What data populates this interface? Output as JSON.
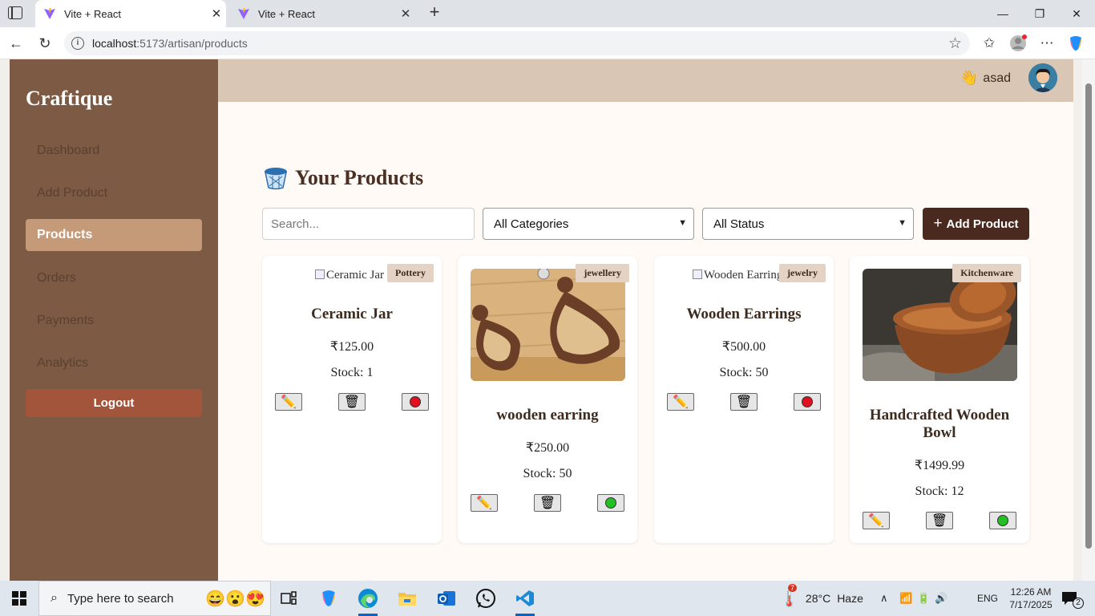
{
  "browser": {
    "tabs": [
      {
        "title": "Vite + React",
        "active": true
      },
      {
        "title": "Vite + React",
        "active": false
      }
    ],
    "url_host": "localhost",
    "url_rest": ":5173/artisan/products"
  },
  "sidebar": {
    "brand": "Craftique",
    "items": [
      {
        "label": "Dashboard",
        "active": false
      },
      {
        "label": "Add Product",
        "active": false
      },
      {
        "label": "Products",
        "active": true
      },
      {
        "label": "Orders",
        "active": false
      },
      {
        "label": "Payments",
        "active": false
      },
      {
        "label": "Analytics",
        "active": false
      }
    ],
    "logout_label": "Logout"
  },
  "header": {
    "username": "asad"
  },
  "page": {
    "title": "Your Products",
    "search_placeholder": "Search...",
    "category_filter": "All Categories",
    "status_filter": "All Status",
    "add_button": "Add Product"
  },
  "products": [
    {
      "name": "Ceramic Jar",
      "category": "Pottery",
      "price": "₹125.00",
      "stock": "Stock: 1",
      "image_alt": "Ceramic Jar",
      "status": "inactive"
    },
    {
      "name": "wooden earring",
      "category": "jewellery",
      "price": "₹250.00",
      "stock": "Stock: 50",
      "image_alt": "",
      "status": "active"
    },
    {
      "name": "Wooden Earrings",
      "category": "jewelry",
      "price": "₹500.00",
      "stock": "Stock: 50",
      "image_alt": "Wooden Earrings",
      "status": "inactive"
    },
    {
      "name": "Handcrafted Wooden Bowl",
      "category": "Kitchenware",
      "price": "₹1499.99",
      "stock": "Stock: 12",
      "image_alt": "",
      "status": "active"
    }
  ],
  "taskbar": {
    "search_placeholder": "Type here to search",
    "weather_temp": "28°C",
    "weather_desc": "Haze",
    "weather_badge": "7",
    "language": "ENG",
    "time": "12:26 AM",
    "date": "7/17/2025",
    "notifications": "2"
  },
  "colors": {
    "sidebar": "#7d5a43",
    "active_nav": "#c49a78",
    "logout": "#a3553c",
    "header": "#d9c6b4",
    "primary_button": "#4a2a1f",
    "badge": "#e4d3c4",
    "status_active": "#22c022",
    "status_inactive": "#e01020"
  }
}
